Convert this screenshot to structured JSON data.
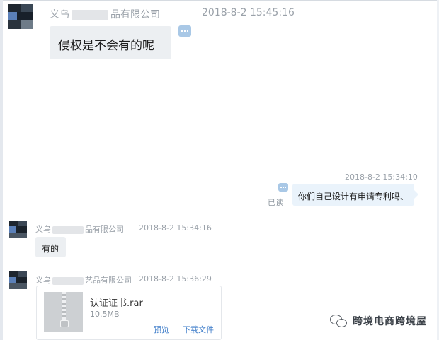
{
  "colors": {
    "incoming_bubble": "#eceff2",
    "outgoing_bubble": "#eaf3fb",
    "meta_text": "#9aa1a9",
    "link": "#3d7cc9",
    "more_icon": "#a9c8e6"
  },
  "icons": {
    "more": "more-options-icon",
    "archive": "zip-archive-icon",
    "watermark": "wechat-icon"
  },
  "messages": [
    {
      "sender_prefix": "义乌",
      "sender_suffix": "品有限公司",
      "time": "2018-8-2 15:45:16",
      "text": "侵权是不会有的呢"
    },
    {
      "time": "2018-8-2 15:34:10",
      "status": "已读",
      "text": "你们自己设计有申请专利吗、"
    },
    {
      "sender_prefix": "义乌",
      "sender_suffix": "品有限公司",
      "time": "2018-8-2 15:34:16",
      "text": "有的"
    },
    {
      "sender_prefix": "义乌",
      "sender_suffix": "艺品有限公司",
      "time": "2018-8-2 15:36:29",
      "file": {
        "name": "认证证书.rar",
        "size": "10.5MB",
        "preview_label": "预览",
        "download_label": "下载文件"
      }
    }
  ],
  "watermark": {
    "text": "跨境电商跨境屋"
  }
}
